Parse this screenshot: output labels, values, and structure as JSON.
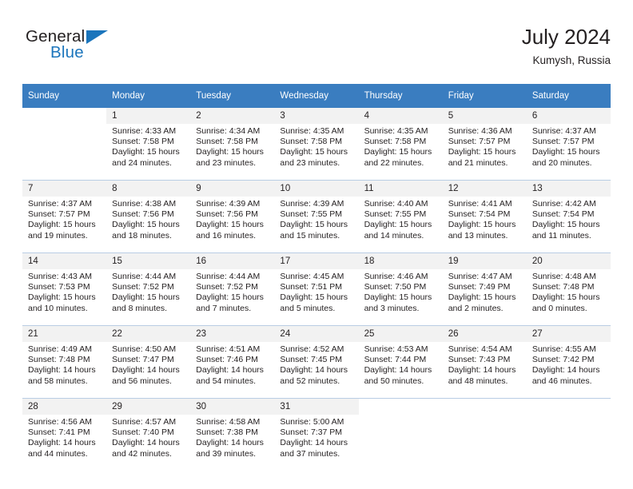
{
  "brand": {
    "name_top": "General",
    "name_bottom": "Blue",
    "triangle_color": "#1b75bc",
    "text_color": "#231f20"
  },
  "header": {
    "title": "July 2024",
    "subtitle": "Kumysh, Russia",
    "header_bg": "#3a7dc0",
    "header_text": "#ffffff",
    "daynum_bg": "#f2f2f2"
  },
  "weekday_headers": [
    "Sunday",
    "Monday",
    "Tuesday",
    "Wednesday",
    "Thursday",
    "Friday",
    "Saturday"
  ],
  "weeks": [
    [
      {
        "day": "",
        "sunrise": "",
        "sunset": "",
        "daylight": "",
        "empty": true
      },
      {
        "day": "1",
        "sunrise": "Sunrise: 4:33 AM",
        "sunset": "Sunset: 7:58 PM",
        "daylight": "Daylight: 15 hours and 24 minutes."
      },
      {
        "day": "2",
        "sunrise": "Sunrise: 4:34 AM",
        "sunset": "Sunset: 7:58 PM",
        "daylight": "Daylight: 15 hours and 23 minutes."
      },
      {
        "day": "3",
        "sunrise": "Sunrise: 4:35 AM",
        "sunset": "Sunset: 7:58 PM",
        "daylight": "Daylight: 15 hours and 23 minutes."
      },
      {
        "day": "4",
        "sunrise": "Sunrise: 4:35 AM",
        "sunset": "Sunset: 7:58 PM",
        "daylight": "Daylight: 15 hours and 22 minutes."
      },
      {
        "day": "5",
        "sunrise": "Sunrise: 4:36 AM",
        "sunset": "Sunset: 7:57 PM",
        "daylight": "Daylight: 15 hours and 21 minutes."
      },
      {
        "day": "6",
        "sunrise": "Sunrise: 4:37 AM",
        "sunset": "Sunset: 7:57 PM",
        "daylight": "Daylight: 15 hours and 20 minutes."
      }
    ],
    [
      {
        "day": "7",
        "sunrise": "Sunrise: 4:37 AM",
        "sunset": "Sunset: 7:57 PM",
        "daylight": "Daylight: 15 hours and 19 minutes."
      },
      {
        "day": "8",
        "sunrise": "Sunrise: 4:38 AM",
        "sunset": "Sunset: 7:56 PM",
        "daylight": "Daylight: 15 hours and 18 minutes."
      },
      {
        "day": "9",
        "sunrise": "Sunrise: 4:39 AM",
        "sunset": "Sunset: 7:56 PM",
        "daylight": "Daylight: 15 hours and 16 minutes."
      },
      {
        "day": "10",
        "sunrise": "Sunrise: 4:39 AM",
        "sunset": "Sunset: 7:55 PM",
        "daylight": "Daylight: 15 hours and 15 minutes."
      },
      {
        "day": "11",
        "sunrise": "Sunrise: 4:40 AM",
        "sunset": "Sunset: 7:55 PM",
        "daylight": "Daylight: 15 hours and 14 minutes."
      },
      {
        "day": "12",
        "sunrise": "Sunrise: 4:41 AM",
        "sunset": "Sunset: 7:54 PM",
        "daylight": "Daylight: 15 hours and 13 minutes."
      },
      {
        "day": "13",
        "sunrise": "Sunrise: 4:42 AM",
        "sunset": "Sunset: 7:54 PM",
        "daylight": "Daylight: 15 hours and 11 minutes."
      }
    ],
    [
      {
        "day": "14",
        "sunrise": "Sunrise: 4:43 AM",
        "sunset": "Sunset: 7:53 PM",
        "daylight": "Daylight: 15 hours and 10 minutes."
      },
      {
        "day": "15",
        "sunrise": "Sunrise: 4:44 AM",
        "sunset": "Sunset: 7:52 PM",
        "daylight": "Daylight: 15 hours and 8 minutes."
      },
      {
        "day": "16",
        "sunrise": "Sunrise: 4:44 AM",
        "sunset": "Sunset: 7:52 PM",
        "daylight": "Daylight: 15 hours and 7 minutes."
      },
      {
        "day": "17",
        "sunrise": "Sunrise: 4:45 AM",
        "sunset": "Sunset: 7:51 PM",
        "daylight": "Daylight: 15 hours and 5 minutes."
      },
      {
        "day": "18",
        "sunrise": "Sunrise: 4:46 AM",
        "sunset": "Sunset: 7:50 PM",
        "daylight": "Daylight: 15 hours and 3 minutes."
      },
      {
        "day": "19",
        "sunrise": "Sunrise: 4:47 AM",
        "sunset": "Sunset: 7:49 PM",
        "daylight": "Daylight: 15 hours and 2 minutes."
      },
      {
        "day": "20",
        "sunrise": "Sunrise: 4:48 AM",
        "sunset": "Sunset: 7:48 PM",
        "daylight": "Daylight: 15 hours and 0 minutes."
      }
    ],
    [
      {
        "day": "21",
        "sunrise": "Sunrise: 4:49 AM",
        "sunset": "Sunset: 7:48 PM",
        "daylight": "Daylight: 14 hours and 58 minutes."
      },
      {
        "day": "22",
        "sunrise": "Sunrise: 4:50 AM",
        "sunset": "Sunset: 7:47 PM",
        "daylight": "Daylight: 14 hours and 56 minutes."
      },
      {
        "day": "23",
        "sunrise": "Sunrise: 4:51 AM",
        "sunset": "Sunset: 7:46 PM",
        "daylight": "Daylight: 14 hours and 54 minutes."
      },
      {
        "day": "24",
        "sunrise": "Sunrise: 4:52 AM",
        "sunset": "Sunset: 7:45 PM",
        "daylight": "Daylight: 14 hours and 52 minutes."
      },
      {
        "day": "25",
        "sunrise": "Sunrise: 4:53 AM",
        "sunset": "Sunset: 7:44 PM",
        "daylight": "Daylight: 14 hours and 50 minutes."
      },
      {
        "day": "26",
        "sunrise": "Sunrise: 4:54 AM",
        "sunset": "Sunset: 7:43 PM",
        "daylight": "Daylight: 14 hours and 48 minutes."
      },
      {
        "day": "27",
        "sunrise": "Sunrise: 4:55 AM",
        "sunset": "Sunset: 7:42 PM",
        "daylight": "Daylight: 14 hours and 46 minutes."
      }
    ],
    [
      {
        "day": "28",
        "sunrise": "Sunrise: 4:56 AM",
        "sunset": "Sunset: 7:41 PM",
        "daylight": "Daylight: 14 hours and 44 minutes."
      },
      {
        "day": "29",
        "sunrise": "Sunrise: 4:57 AM",
        "sunset": "Sunset: 7:40 PM",
        "daylight": "Daylight: 14 hours and 42 minutes."
      },
      {
        "day": "30",
        "sunrise": "Sunrise: 4:58 AM",
        "sunset": "Sunset: 7:38 PM",
        "daylight": "Daylight: 14 hours and 39 minutes."
      },
      {
        "day": "31",
        "sunrise": "Sunrise: 5:00 AM",
        "sunset": "Sunset: 7:37 PM",
        "daylight": "Daylight: 14 hours and 37 minutes."
      },
      {
        "day": "",
        "sunrise": "",
        "sunset": "",
        "daylight": "",
        "empty": true
      },
      {
        "day": "",
        "sunrise": "",
        "sunset": "",
        "daylight": "",
        "empty": true
      },
      {
        "day": "",
        "sunrise": "",
        "sunset": "",
        "daylight": "",
        "empty": true
      }
    ]
  ]
}
